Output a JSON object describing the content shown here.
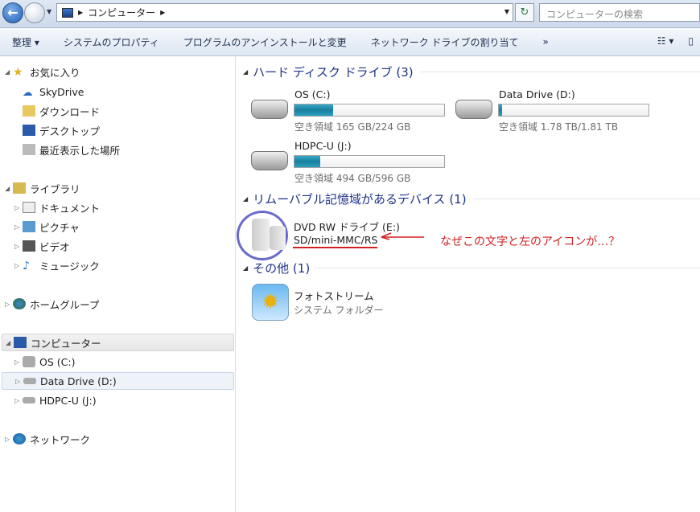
{
  "address": {
    "crumbs": [
      "コンピューター"
    ],
    "search_placeholder": "コンピューターの検索"
  },
  "toolbar": {
    "items": [
      "整理 ▾",
      "システムのプロパティ",
      "プログラムのアンインストールと変更",
      "ネットワーク ドライブの割り当て",
      "»"
    ]
  },
  "sidebar": {
    "favorites": {
      "label": "お気に入り",
      "items": [
        "SkyDrive",
        "ダウンロード",
        "デスクトップ",
        "最近表示した場所"
      ]
    },
    "libraries": {
      "label": "ライブラリ",
      "items": [
        "ドキュメント",
        "ピクチャ",
        "ビデオ",
        "ミュージック"
      ]
    },
    "homegroup": "ホームグループ",
    "computer": {
      "label": "コンピューター",
      "items": [
        "OS (C:)",
        "Data Drive (D:)",
        "HDPC-U (J:)"
      ]
    },
    "network": "ネットワーク"
  },
  "groups": {
    "hdd": {
      "title": "ハード ディスク ドライブ (3)",
      "drives": [
        {
          "name": "OS (C:)",
          "free": "空き領域 165 GB/224 GB",
          "used_pct": 26
        },
        {
          "name": "Data Drive (D:)",
          "free": "空き領域 1.78 TB/1.81 TB",
          "used_pct": 2
        },
        {
          "name": "HDPC-U (J:)",
          "free": "空き領域 494 GB/596 GB",
          "used_pct": 17
        }
      ]
    },
    "removable": {
      "title": "リムーバブル記憶域があるデバイス (1)",
      "device": {
        "name": "DVD RW ドライブ (E:)",
        "sub": "SD/mini-MMC/RS"
      }
    },
    "other": {
      "title": "その他 (1)",
      "item": {
        "name": "フォトストリーム",
        "sub": "システム フォルダー"
      }
    }
  },
  "annotation": "なぜこの文字と左のアイコンが…？",
  "colors": {
    "annotation": "#d02020",
    "circle": "#6a6acc",
    "group_title": "#1e3287"
  }
}
